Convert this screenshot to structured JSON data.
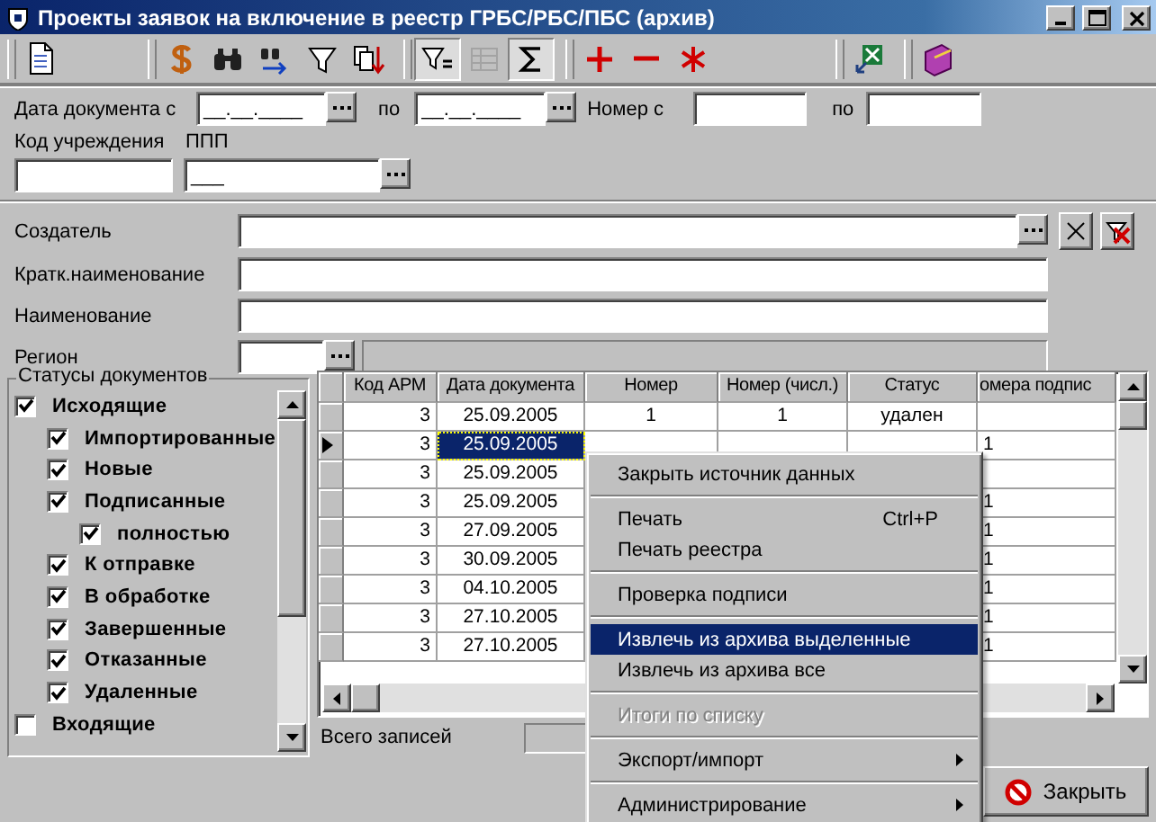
{
  "window": {
    "title": "Проекты заявок на включение в реестр ГРБС/РБС/ПБС (архив)"
  },
  "toolbar": [
    {
      "buttons": [
        {
          "kind": "document",
          "pressed": false,
          "disabled": false
        }
      ]
    },
    {
      "buttons": [
        {
          "kind": "dollar",
          "pressed": false,
          "disabled": false
        },
        {
          "kind": "find",
          "pressed": false,
          "disabled": false
        },
        {
          "kind": "find-next",
          "pressed": false,
          "disabled": false
        },
        {
          "kind": "filter",
          "pressed": false,
          "disabled": false
        },
        {
          "kind": "sort",
          "pressed": false,
          "disabled": false
        }
      ]
    },
    {
      "buttons": [
        {
          "kind": "filter-equal",
          "pressed": true,
          "disabled": false
        },
        {
          "kind": "columns",
          "pressed": false,
          "disabled": true
        },
        {
          "kind": "sum",
          "pressed": true,
          "disabled": false
        }
      ]
    },
    {
      "buttons": [
        {
          "kind": "add",
          "pressed": false,
          "disabled": false
        },
        {
          "kind": "remove",
          "pressed": false,
          "disabled": false
        },
        {
          "kind": "asterisk",
          "pressed": false,
          "disabled": false
        }
      ]
    },
    {
      "buttons": [
        {
          "kind": "export",
          "pressed": false,
          "disabled": false
        }
      ]
    },
    {
      "buttons": [
        {
          "kind": "book",
          "pressed": false,
          "disabled": false
        }
      ]
    }
  ],
  "filters": {
    "date_from": {
      "label": "Дата документа с",
      "value": "__.__.____"
    },
    "date_to": {
      "label": "по",
      "value": "__.__.____"
    },
    "number_from": {
      "label": "Номер с"
    },
    "number_to": {
      "label": "по"
    },
    "org_code": {
      "label": "Код учреждения"
    },
    "ppp": {
      "label": "ППП",
      "value": "___"
    }
  },
  "details": [
    {
      "label": "Создатель",
      "kind": "lookup"
    },
    {
      "label": "Кратк.наименование",
      "kind": "text"
    },
    {
      "label": "Наименование",
      "kind": "text"
    },
    {
      "label": "Регион",
      "kind": "region"
    }
  ],
  "statuses": {
    "title": "Статусы документов",
    "items": [
      {
        "label": "Исходящие",
        "checked": true,
        "children": [
          {
            "label": "Импортированные",
            "checked": true
          },
          {
            "label": "Новые",
            "checked": true
          },
          {
            "label": "Подписанные",
            "checked": true,
            "children": [
              {
                "label": "полностью",
                "checked": true
              }
            ]
          },
          {
            "label": "К отправке",
            "checked": true
          },
          {
            "label": "В обработке",
            "checked": true
          },
          {
            "label": "Завершенные",
            "checked": true
          },
          {
            "label": "Отказанные",
            "checked": true
          },
          {
            "label": "Удаленные",
            "checked": true
          }
        ]
      },
      {
        "label": "Входящие",
        "checked": false
      }
    ]
  },
  "grid": {
    "columns": [
      "Код АРМ",
      "Дата документа",
      "Номер",
      "Номер (числ.)",
      "Статус",
      "омера подпис"
    ],
    "rows": [
      {
        "selected": false,
        "cells": [
          "3",
          "25.09.2005",
          "1",
          "1",
          "удален",
          null
        ]
      },
      {
        "selected": true,
        "cells": [
          "3",
          "25.09.2005",
          null,
          null,
          null,
          "1"
        ]
      },
      {
        "selected": false,
        "cells": [
          "3",
          "25.09.2005",
          null,
          null,
          null,
          null
        ]
      },
      {
        "selected": false,
        "cells": [
          "3",
          "25.09.2005",
          null,
          null,
          null,
          "1"
        ]
      },
      {
        "selected": false,
        "cells": [
          "3",
          "27.09.2005",
          null,
          null,
          null,
          "1"
        ]
      },
      {
        "selected": false,
        "cells": [
          "3",
          "30.09.2005",
          null,
          null,
          null,
          "1"
        ]
      },
      {
        "selected": false,
        "cells": [
          "3",
          "04.10.2005",
          null,
          null,
          null,
          "1"
        ]
      },
      {
        "selected": false,
        "cells": [
          "3",
          "27.10.2005",
          null,
          null,
          null,
          "1"
        ]
      },
      {
        "selected": false,
        "cells": [
          "3",
          "27.10.2005",
          null,
          null,
          null,
          "1"
        ]
      }
    ],
    "total_label": "Всего записей"
  },
  "close_button": "Закрыть",
  "context_menu": [
    {
      "kind": "item",
      "label": "Закрыть источник данных",
      "selected": false,
      "disabled": false,
      "submenu": false
    },
    {
      "kind": "separator"
    },
    {
      "kind": "item",
      "label": "Печать",
      "shortcut": "Ctrl+P",
      "selected": false,
      "disabled": false,
      "submenu": false
    },
    {
      "kind": "item",
      "label": "Печать реестра",
      "selected": false,
      "disabled": false,
      "submenu": false
    },
    {
      "kind": "separator"
    },
    {
      "kind": "item",
      "label": "Проверка подписи",
      "selected": false,
      "disabled": false,
      "submenu": false
    },
    {
      "kind": "separator"
    },
    {
      "kind": "item",
      "label": "Извлечь из архива выделенные",
      "selected": true,
      "disabled": false,
      "submenu": false
    },
    {
      "kind": "item",
      "label": "Извлечь из архива все",
      "selected": false,
      "disabled": false,
      "submenu": false
    },
    {
      "kind": "separator"
    },
    {
      "kind": "item",
      "label": "Итоги по списку",
      "selected": false,
      "disabled": true,
      "submenu": false
    },
    {
      "kind": "separator"
    },
    {
      "kind": "item",
      "label": "Экспорт/импорт",
      "selected": false,
      "disabled": false,
      "submenu": true
    },
    {
      "kind": "separator"
    },
    {
      "kind": "item",
      "label": "Администрирование",
      "selected": false,
      "disabled": false,
      "submenu": true
    }
  ]
}
